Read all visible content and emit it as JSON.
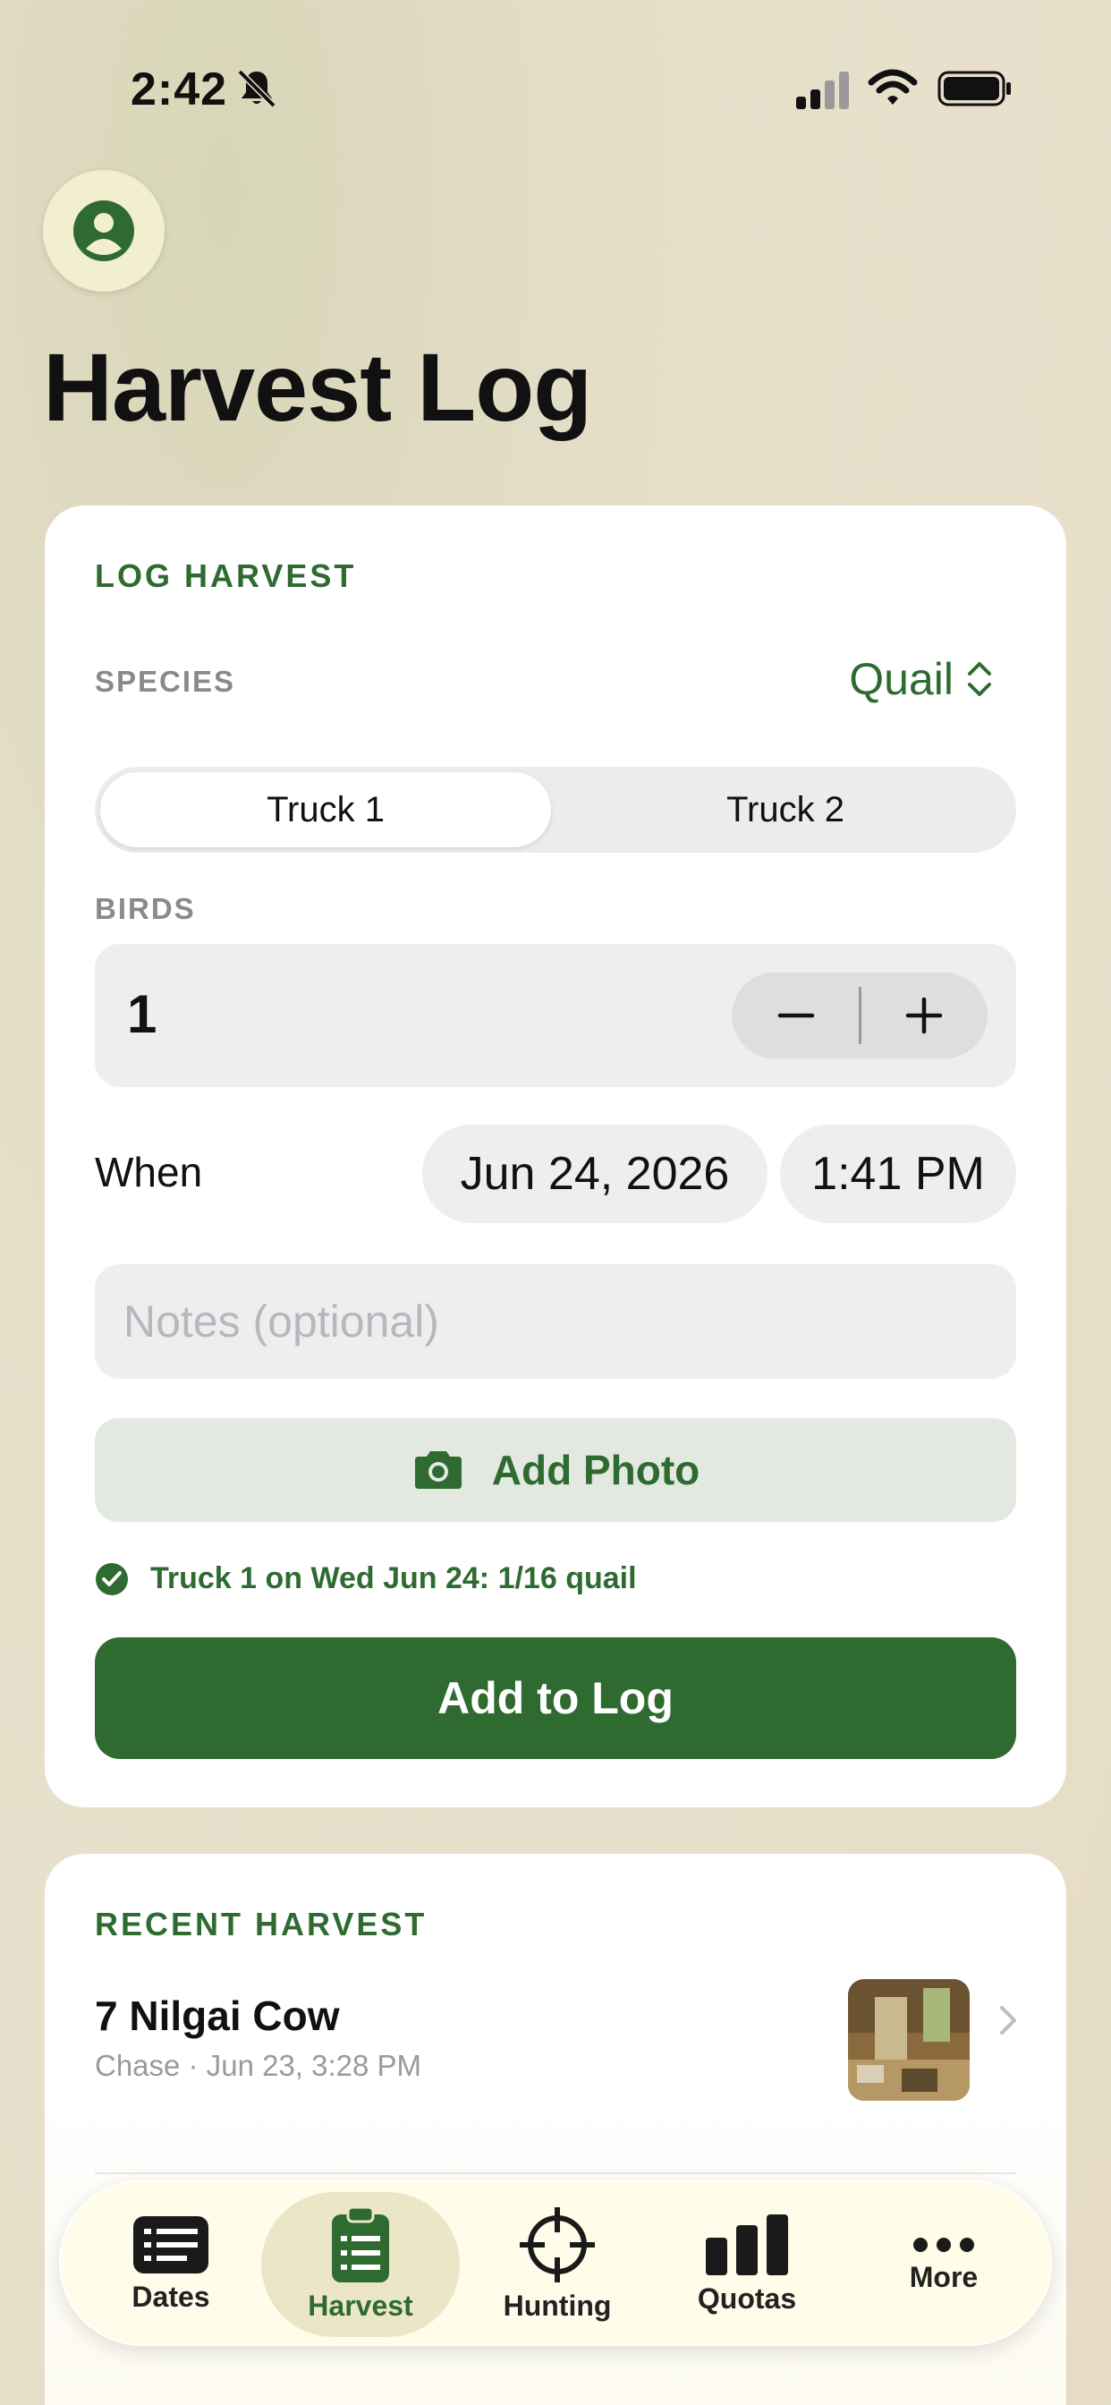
{
  "status_bar": {
    "time": "2:42"
  },
  "header": {
    "title": "Harvest Log"
  },
  "log_harvest": {
    "section_title": "LOG HARVEST",
    "species_label": "SPECIES",
    "species_value": "Quail",
    "segments": [
      "Truck 1",
      "Truck 2"
    ],
    "selected_segment": "Truck 1",
    "birds_label": "BIRDS",
    "birds_count": "1",
    "when_label": "When",
    "date": "Jun 24, 2026",
    "time": "1:41 PM",
    "notes_placeholder": "Notes (optional)",
    "add_photo_label": "Add Photo",
    "status_text": "Truck 1 on Wed Jun 24: 1/16 quail",
    "add_button": "Add to Log"
  },
  "recent_harvest": {
    "section_title": "RECENT HARVEST",
    "items": [
      {
        "name": "7 Nilgai Cow",
        "subtitle": "Chase · Jun 23, 3:28 PM"
      }
    ]
  },
  "tabbar": {
    "tabs": [
      {
        "label": "Dates"
      },
      {
        "label": "Harvest"
      },
      {
        "label": "Hunting"
      },
      {
        "label": "Quotas"
      },
      {
        "label": "More"
      }
    ],
    "active": "Harvest"
  },
  "colors": {
    "accent": "#2f6b31",
    "card": "#ffffff",
    "field": "#eeeef0"
  }
}
